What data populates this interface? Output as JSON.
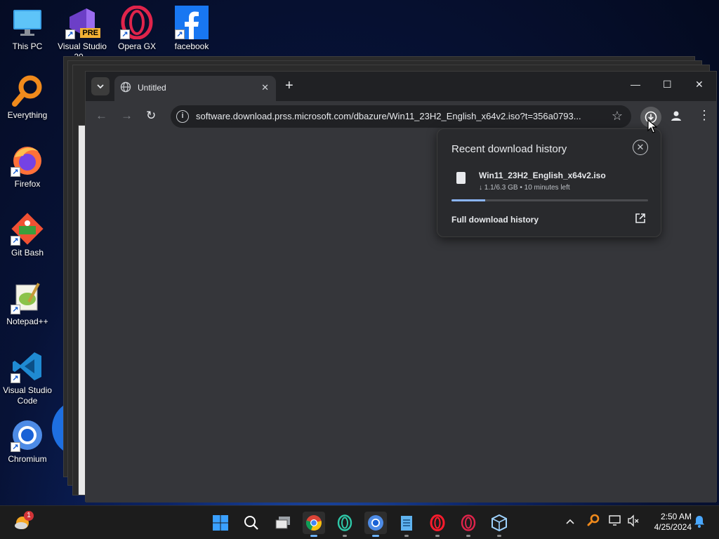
{
  "desktop": {
    "icons": [
      {
        "label": "This PC"
      },
      {
        "label": "Visual Studio 20..."
      },
      {
        "label": "Opera GX"
      },
      {
        "label": "facebook"
      },
      {
        "label": "Everything"
      },
      {
        "label": "Firefox"
      },
      {
        "label": "Git Bash"
      },
      {
        "label": "Notepad++"
      },
      {
        "label": "Visual Studio Code"
      },
      {
        "label": "Chromium"
      }
    ],
    "vs_badge": "PRE"
  },
  "browser": {
    "tab_title": "Untitled",
    "new_tab_glyph": "+",
    "url": "software.download.prss.microsoft.com/dbazure/Win11_23H2_English_x64v2.iso?t=356a0793...",
    "controls": {
      "minimize": "—",
      "maximize": "☐",
      "close": "✕"
    }
  },
  "download_bubble": {
    "title": "Recent download history",
    "file_name": "Win11_23H2_English_x64v2.iso",
    "status": "↓ 1.1/6.3 GB • 10 minutes left",
    "progress_percent": 17,
    "full_history_label": "Full download history"
  },
  "taskbar": {
    "notification_badge": "1",
    "clock_time": "2:50 AM",
    "clock_date": "4/25/2024"
  },
  "colors": {
    "accent": "#8ab4f8",
    "browser_bg": "#202124",
    "toolbar_bg": "#35363a"
  }
}
